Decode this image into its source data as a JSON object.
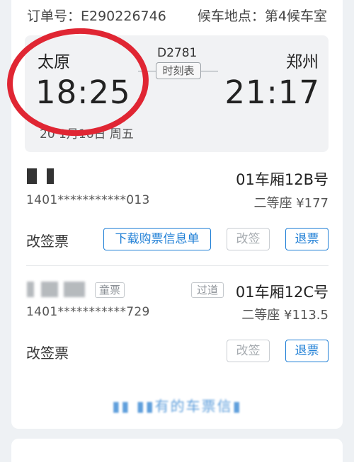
{
  "header": {
    "order_text": "订单号：E290226746",
    "waiting_text": "候车地点：第4候车室"
  },
  "trip": {
    "from_city": "太原",
    "to_city": "郑州",
    "depart_time": "18:25",
    "arrive_time": "21:17",
    "train_no": "D2781",
    "schedule_label": "时刻表",
    "date_text": "20   1月16日 周五"
  },
  "passengers": [
    {
      "id_no": "1401***********013",
      "coach_seat": "01车厢12B号",
      "seat_class_price": "二等座 ¥177",
      "status_label": "改签票",
      "buttons": {
        "download": "下载购票信息单",
        "change": "改签",
        "refund": "退票"
      }
    },
    {
      "ticket_type_tag": "童票",
      "via_tag": "过道",
      "id_no": "1401***********729",
      "coach_seat": "01车厢12C号",
      "seat_class_price": "二等座 ¥113.5",
      "status_label": "改签票",
      "buttons": {
        "change": "改签",
        "refund": "退票"
      }
    }
  ],
  "footer": {
    "more_link": "▮▮ ▮▮有的车票信▮"
  },
  "colors": {
    "accent": "#1f7fd6",
    "annotation_circle": "#e02633",
    "trip_bg": "#f1f2f4"
  }
}
